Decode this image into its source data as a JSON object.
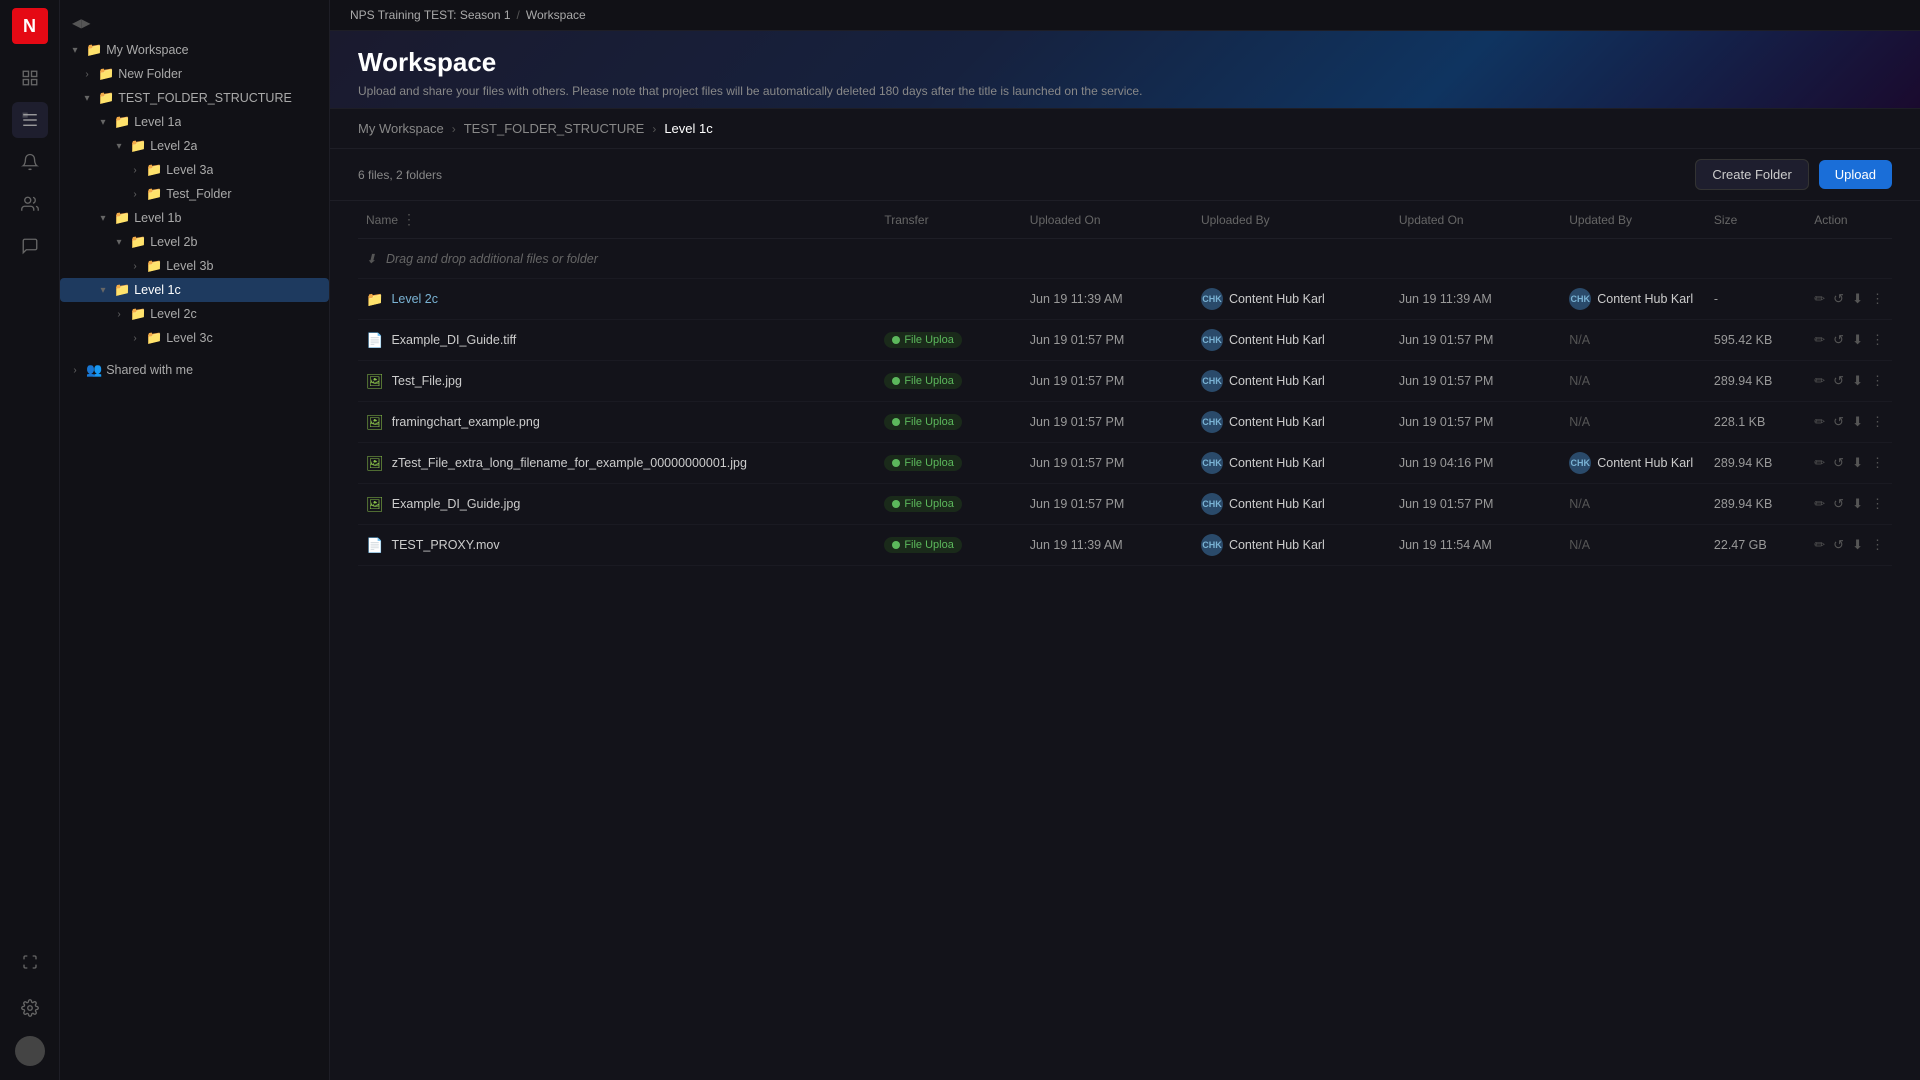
{
  "app": {
    "logo": "N",
    "project": "NPS Training TEST: Season 1",
    "section": "Workspace"
  },
  "page": {
    "title": "Workspace",
    "subtitle": "Upload and share your files with others. Please note that project files will be automatically deleted 180 days after the title is launched on the service."
  },
  "breadcrumb": [
    {
      "label": "My Workspace",
      "active": false
    },
    {
      "label": "TEST_FOLDER_STRUCTURE",
      "active": false
    },
    {
      "label": "Level 1c",
      "active": true
    }
  ],
  "toolbar": {
    "file_count": "6 files, 2 folders",
    "create_folder_label": "Create Folder",
    "upload_label": "Upload"
  },
  "table": {
    "columns": [
      "Name",
      "Transfer",
      "Uploaded On",
      "Uploaded By",
      "Updated On",
      "Updated By",
      "Size",
      "Action"
    ],
    "drop_zone_text": "Drag and drop additional files or folder",
    "rows": [
      {
        "name": "Level 2c",
        "type": "folder",
        "transfer": "",
        "uploaded_on": "Jun 19 11:39 AM",
        "uploaded_by": "Content Hub Karl",
        "uploaded_by_initials": "CHK",
        "updated_on": "Jun 19 11:39 AM",
        "updated_by": "Content Hub Karl",
        "updated_by_initials": "CHK",
        "size": "-",
        "is_folder": true
      },
      {
        "name": "Example_DI_Guide.tiff",
        "type": "doc",
        "transfer": "File Uploa",
        "uploaded_on": "Jun 19 01:57 PM",
        "uploaded_by": "Content Hub Karl",
        "uploaded_by_initials": "CHK",
        "updated_on": "Jun 19 01:57 PM",
        "updated_by": "",
        "updated_by_initials": "",
        "size": "595.42 KB",
        "is_folder": false
      },
      {
        "name": "Test_File.jpg",
        "type": "img",
        "transfer": "File Uploa",
        "uploaded_on": "Jun 19 01:57 PM",
        "uploaded_by": "Content Hub Karl",
        "uploaded_by_initials": "CHK",
        "updated_on": "Jun 19 01:57 PM",
        "updated_by": "",
        "updated_by_initials": "",
        "size": "289.94 KB",
        "is_folder": false
      },
      {
        "name": "framingchart_example.png",
        "type": "img",
        "transfer": "File Uploa",
        "uploaded_on": "Jun 19 01:57 PM",
        "uploaded_by": "Content Hub Karl",
        "uploaded_by_initials": "CHK",
        "updated_on": "Jun 19 01:57 PM",
        "updated_by": "",
        "updated_by_initials": "",
        "size": "228.1 KB",
        "is_folder": false
      },
      {
        "name": "zTest_File_extra_long_filename_for_example_00000000001.jpg",
        "type": "img",
        "transfer": "File Uploa",
        "uploaded_on": "Jun 19 01:57 PM",
        "uploaded_by": "Content Hub Karl",
        "uploaded_by_initials": "CHK",
        "updated_on": "Jun 19 04:16 PM",
        "updated_by": "Content Hub Karl",
        "updated_by_initials": "CHK",
        "size": "289.94 KB",
        "is_folder": false
      },
      {
        "name": "Example_DI_Guide.jpg",
        "type": "img",
        "transfer": "File Uploa",
        "uploaded_on": "Jun 19 01:57 PM",
        "uploaded_by": "Content Hub Karl",
        "uploaded_by_initials": "CHK",
        "updated_on": "Jun 19 01:57 PM",
        "updated_by": "",
        "updated_by_initials": "",
        "size": "289.94 KB",
        "is_folder": false
      },
      {
        "name": "TEST_PROXY.mov",
        "type": "doc",
        "transfer": "File Uploa",
        "uploaded_on": "Jun 19 11:39 AM",
        "uploaded_by": "Content Hub Karl",
        "uploaded_by_initials": "CHK",
        "updated_on": "Jun 19 11:54 AM",
        "updated_by": "",
        "updated_by_initials": "",
        "size": "22.47 GB",
        "is_folder": false
      }
    ]
  },
  "sidebar": {
    "workspace_label": "My Workspace",
    "new_folder_label": "New Folder",
    "test_folder_label": "TEST_FOLDER_STRUCTURE",
    "level1a_label": "Level 1a",
    "level2a_label": "Level 2a",
    "level3a_label": "Level 3a",
    "test_folder2_label": "Test_Folder",
    "level1b_label": "Level 1b",
    "level2b_label": "Level 2b",
    "level3b_label": "Level 3b",
    "level1c_label": "Level 1c",
    "level2c_label": "Level 2c",
    "level3c_label": "Level 3c",
    "shared_label": "Shared with me"
  },
  "icons": {
    "dashboard": "⊞",
    "workspace": "🗂",
    "bell": "🔔",
    "people": "👥",
    "grid": "⊞",
    "settings": "⚙",
    "chevron_right": "›",
    "chevron_down": "▾",
    "chevron_small": "›",
    "folder": "📁",
    "file": "📄",
    "image": "🖼",
    "edit": "✏",
    "share": "↺",
    "download": "⬇",
    "more": "⋮",
    "collapse": "◀▶"
  }
}
